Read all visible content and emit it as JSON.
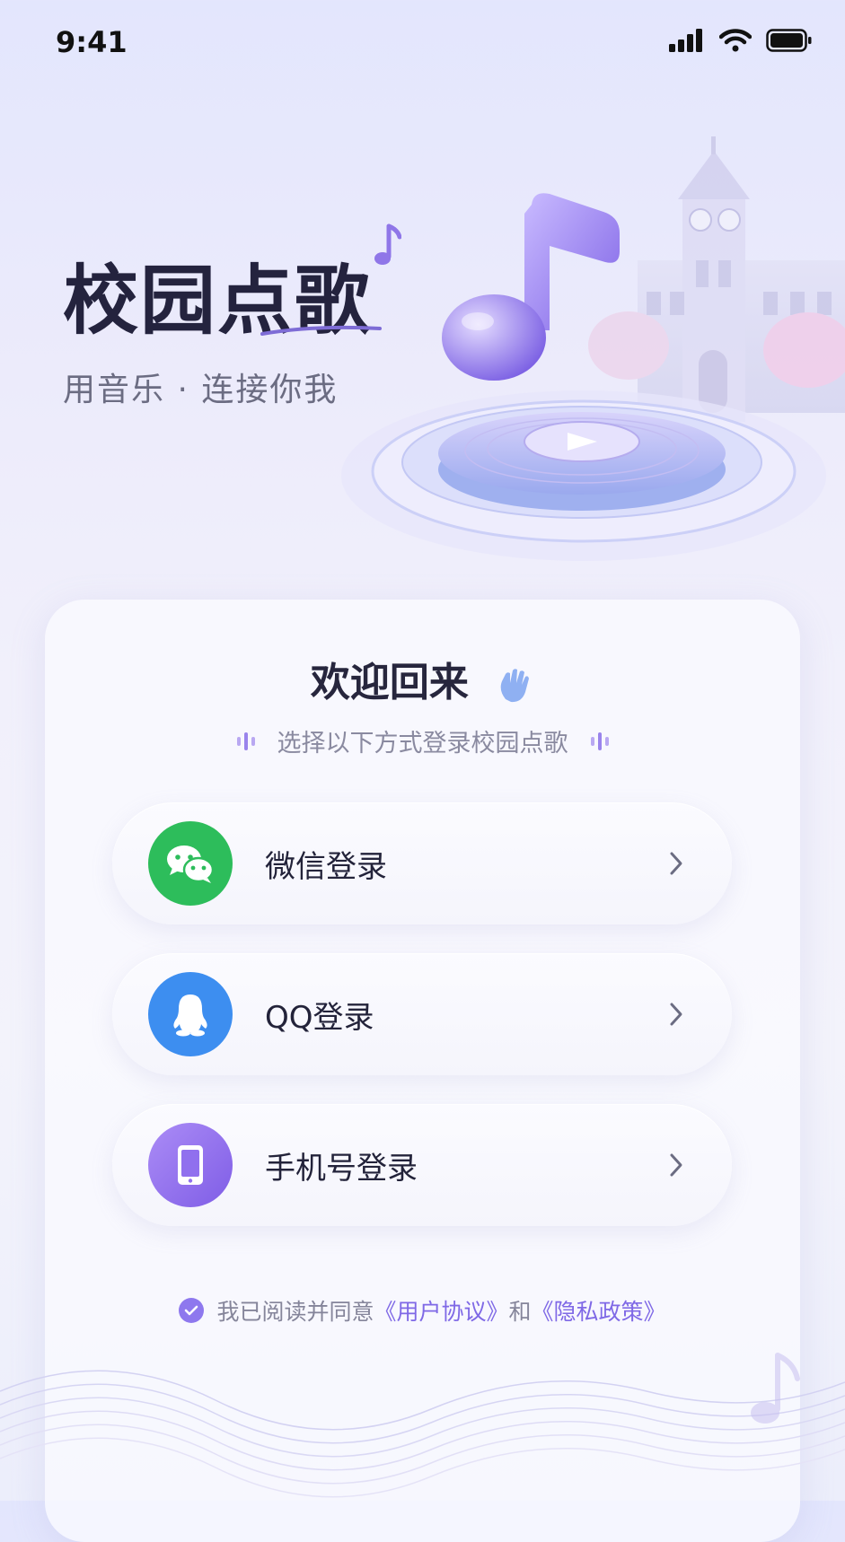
{
  "status_bar": {
    "time": "9:41"
  },
  "hero": {
    "title": "校园点歌",
    "subtitle": "用音乐 · 连接你我"
  },
  "card": {
    "welcome": "欢迎回来",
    "hint": "选择以下方式登录校园点歌"
  },
  "login_options": [
    {
      "label": "微信登录",
      "icon": "wechat-icon",
      "color": "#2dbd5b"
    },
    {
      "label": "QQ登录",
      "icon": "qq-penguin-icon",
      "color": "#3d8ef0"
    },
    {
      "label": "手机号登录",
      "icon": "phone-icon",
      "color": "#9070ee"
    }
  ],
  "agreement": {
    "prefix": "我已阅读并同意",
    "user_agreement": "《用户协议》",
    "and": "和",
    "privacy_policy": "《隐私政策》",
    "checked": true
  },
  "colors": {
    "accent": "#8e78ee",
    "wechat": "#2dbd5b",
    "qq": "#3d8ef0",
    "phone": "#9070ee"
  }
}
